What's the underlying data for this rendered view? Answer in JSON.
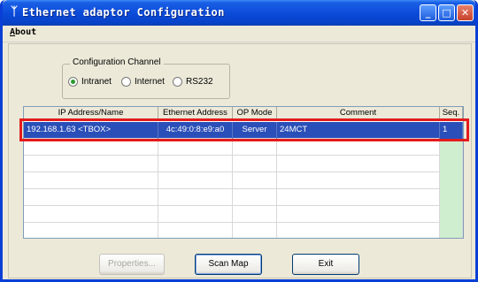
{
  "window": {
    "title": "Ethernet adaptor Configuration",
    "icon": "network-adaptor-icon"
  },
  "titlebar_buttons": {
    "minimize": "_",
    "maximize": "□",
    "close": "✕"
  },
  "menu": {
    "items": [
      {
        "label": "About"
      }
    ]
  },
  "channel": {
    "legend": "Configuration Channel",
    "options": [
      {
        "label": "Intranet",
        "checked": true
      },
      {
        "label": "Internet",
        "checked": false
      },
      {
        "label": "RS232",
        "checked": false
      }
    ]
  },
  "table": {
    "columns": [
      "IP Address/Name",
      "Ethernet Address",
      "OP Mode",
      "Comment",
      "Seq."
    ],
    "rows": [
      {
        "ip": "192.168.1.63 <TBOX>",
        "mac": "4c:49:0:8:e9:a0",
        "mode": "Server",
        "comment": "24MCT",
        "seq": "1"
      }
    ]
  },
  "buttons": {
    "properties": "Properties...",
    "scan": "Scan Map",
    "exit": "Exit"
  },
  "colors": {
    "selection": "#2a4fb8",
    "highlight": "#e31c1c",
    "seq_column": "#cfeecf",
    "titlebar": "#0a4ad8"
  }
}
